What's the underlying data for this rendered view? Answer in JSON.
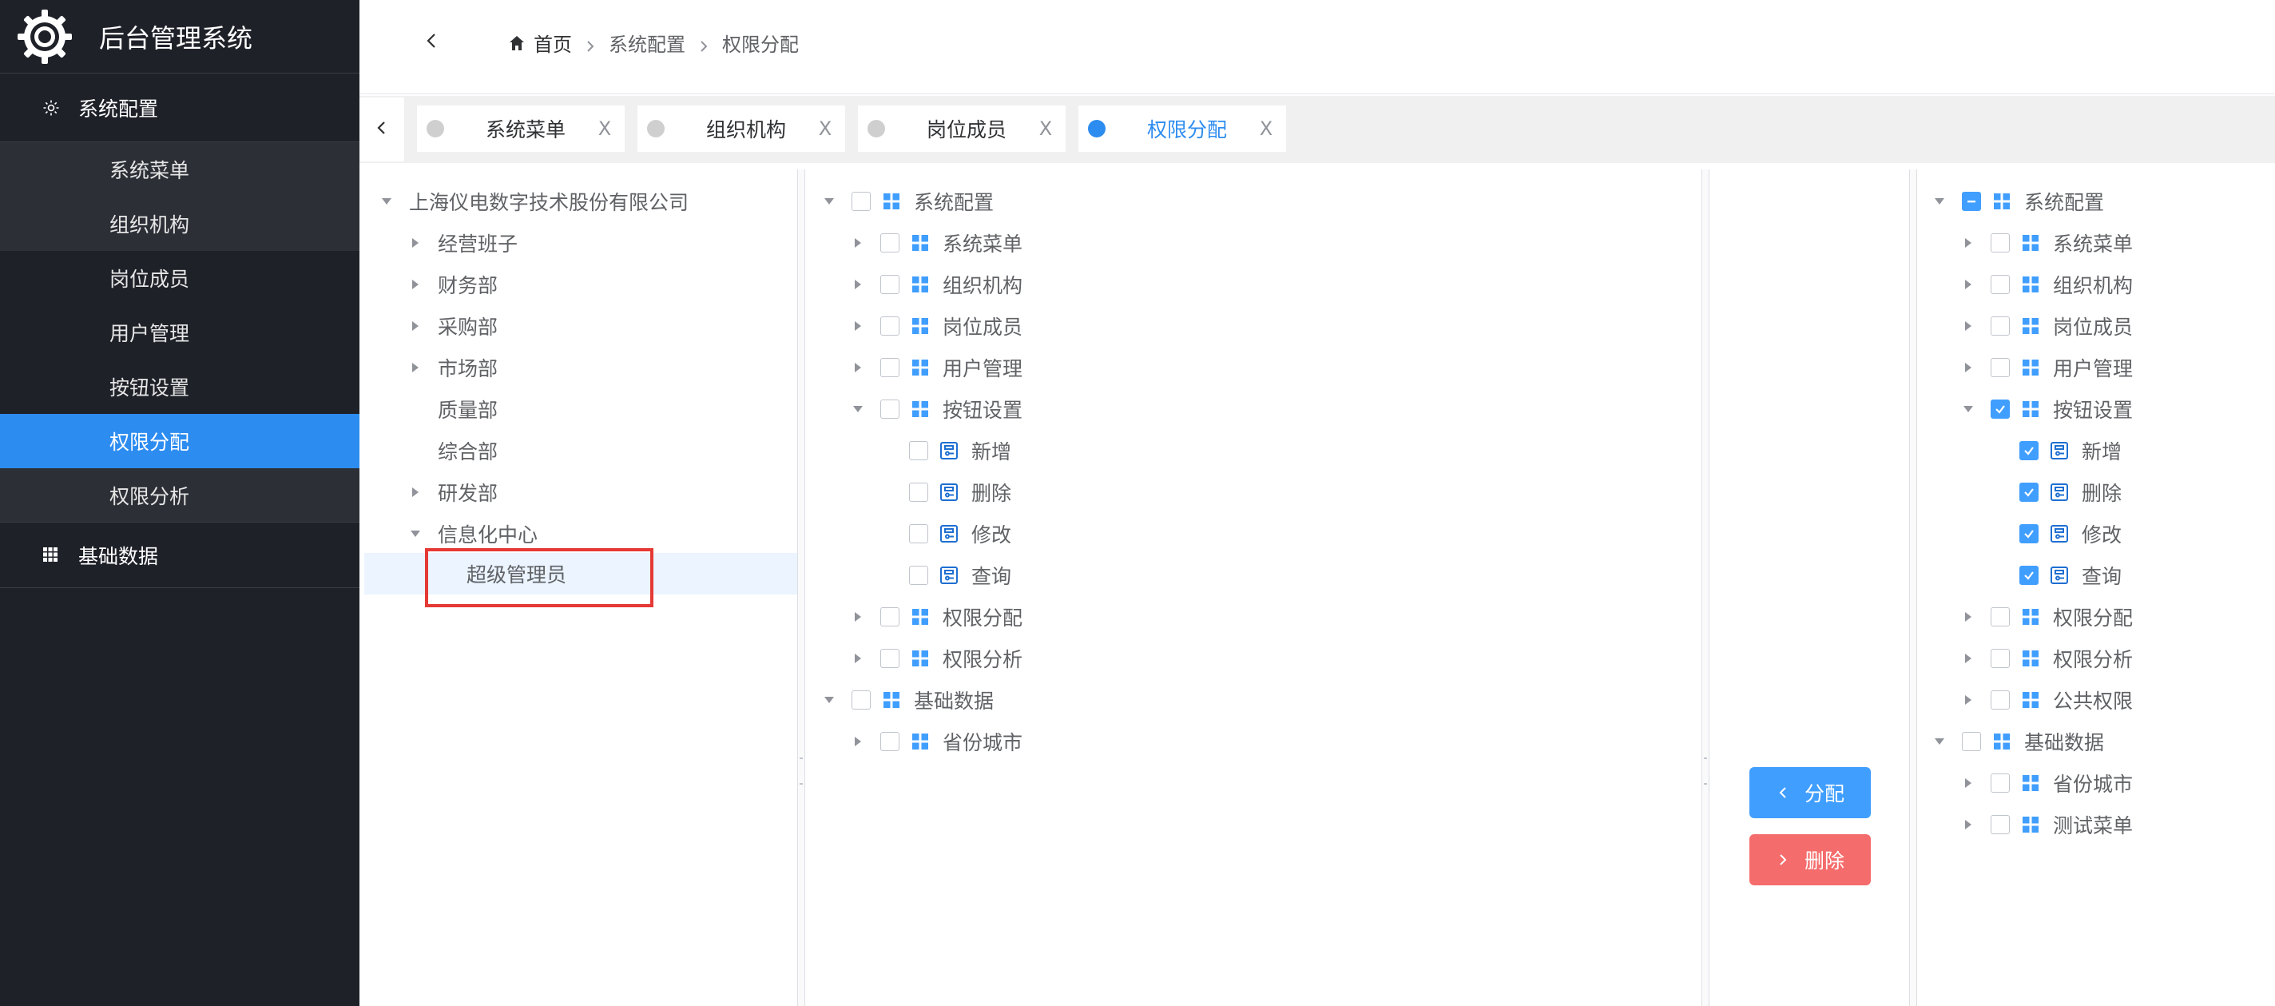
{
  "app": {
    "title": "后台管理系统"
  },
  "sidebar": {
    "groups": [
      {
        "label": "系统配置",
        "icon": "gear-icon"
      },
      {
        "label": "基础数据",
        "icon": "grid-icon"
      }
    ],
    "items": [
      {
        "label": "系统菜单"
      },
      {
        "label": "组织机构"
      },
      {
        "label": "岗位成员"
      },
      {
        "label": "用户管理"
      },
      {
        "label": "按钮设置"
      },
      {
        "label": "权限分配",
        "active": true
      },
      {
        "label": "权限分析"
      }
    ]
  },
  "breadcrumb": {
    "home": "首页",
    "level1": "系统配置",
    "level2": "权限分配"
  },
  "tabs": [
    {
      "label": "系统菜单",
      "close": "X"
    },
    {
      "label": "组织机构",
      "close": "X"
    },
    {
      "label": "岗位成员",
      "close": "X"
    },
    {
      "label": "权限分配",
      "close": "X",
      "active": true
    }
  ],
  "org_tree": [
    {
      "label": "上海仪电数字技术股份有限公司",
      "caret": "down"
    },
    {
      "label": "经营班子",
      "caret": "right"
    },
    {
      "label": "财务部",
      "caret": "right"
    },
    {
      "label": "采购部",
      "caret": "right"
    },
    {
      "label": "市场部",
      "caret": "right"
    },
    {
      "label": "质量部",
      "caret": "none"
    },
    {
      "label": "综合部",
      "caret": "none"
    },
    {
      "label": "研发部",
      "caret": "right"
    },
    {
      "label": "信息化中心",
      "caret": "down"
    },
    {
      "label": "超级管理员",
      "caret": "none",
      "selected": true
    }
  ],
  "perm_tree": [
    {
      "label": "系统配置",
      "checked": false
    },
    {
      "label": "系统菜单",
      "checked": false
    },
    {
      "label": "组织机构",
      "checked": false
    },
    {
      "label": "岗位成员",
      "checked": false
    },
    {
      "label": "用户管理",
      "checked": false
    },
    {
      "label": "按钮设置",
      "checked": false
    },
    {
      "label": "新增",
      "checked": false
    },
    {
      "label": "删除",
      "checked": false
    },
    {
      "label": "修改",
      "checked": false
    },
    {
      "label": "查询",
      "checked": false
    },
    {
      "label": "权限分配",
      "checked": false
    },
    {
      "label": "权限分析",
      "checked": false
    },
    {
      "label": "基础数据",
      "checked": false
    },
    {
      "label": "省份城市",
      "checked": false
    }
  ],
  "assigned_tree": [
    {
      "label": "系统配置",
      "state": "indeterminate"
    },
    {
      "label": "系统菜单",
      "state": "unchecked"
    },
    {
      "label": "组织机构",
      "state": "unchecked"
    },
    {
      "label": "岗位成员",
      "state": "unchecked"
    },
    {
      "label": "用户管理",
      "state": "unchecked"
    },
    {
      "label": "按钮设置",
      "state": "checked"
    },
    {
      "label": "新增",
      "state": "checked"
    },
    {
      "label": "删除",
      "state": "checked"
    },
    {
      "label": "修改",
      "state": "checked"
    },
    {
      "label": "查询",
      "state": "checked"
    },
    {
      "label": "权限分配",
      "state": "unchecked"
    },
    {
      "label": "权限分析",
      "state": "unchecked"
    },
    {
      "label": "公共权限",
      "state": "unchecked"
    },
    {
      "label": "基础数据",
      "state": "unchecked"
    },
    {
      "label": "省份城市",
      "state": "unchecked"
    },
    {
      "label": "测试菜单",
      "state": "unchecked"
    }
  ],
  "actions": {
    "assign_label": "分配",
    "delete_label": "删除"
  },
  "colors": {
    "sidebar_bg": "#1f2129",
    "accent": "#2d8cf0",
    "primary_button": "#409eff",
    "danger_button": "#f56c6c",
    "selection_box": "#e53935"
  }
}
